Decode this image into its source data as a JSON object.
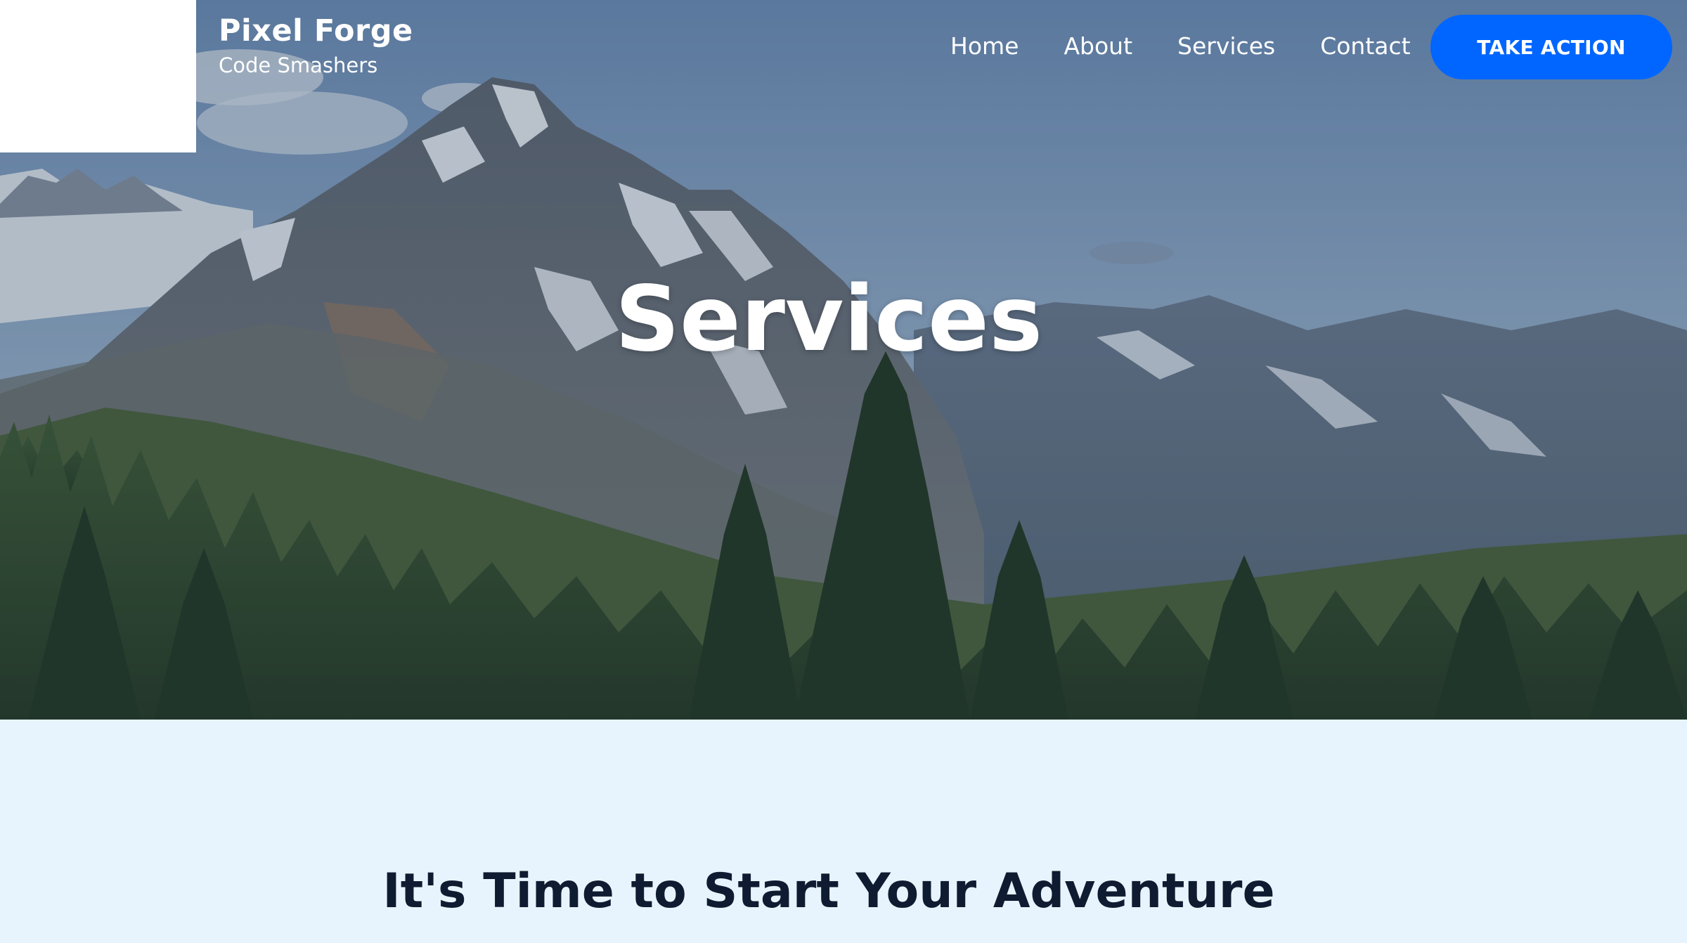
{
  "header": {
    "brand_name": "Pixel Forge",
    "brand_tagline": "Code Smashers",
    "nav": [
      {
        "label": "Home"
      },
      {
        "label": "About"
      },
      {
        "label": "Services"
      },
      {
        "label": "Contact"
      }
    ],
    "cta_label": "TAKE ACTION"
  },
  "hero": {
    "title": "Services"
  },
  "section": {
    "heading": "It's Time to Start Your Adventure"
  },
  "colors": {
    "accent": "#0066ff",
    "section_bg": "#e8f4fd",
    "heading_text": "#0f1b30"
  }
}
